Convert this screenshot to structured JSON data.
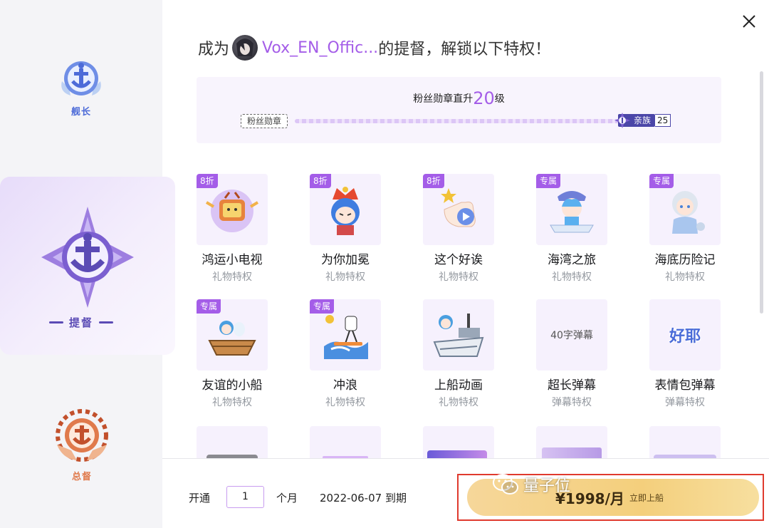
{
  "left_rail": {
    "ranks": [
      {
        "label": "舰长"
      },
      {
        "label": "提督"
      },
      {
        "label": "总督"
      }
    ]
  },
  "heading": {
    "prefix": "成为",
    "streamer_name": "Vox_EN_Offic...",
    "suffix": "的提督，解锁以下特权！"
  },
  "medal": {
    "title_prefix": "粉丝勋章直升",
    "level": "20",
    "title_suffix": "级",
    "start_label": "粉丝勋章",
    "end_badge": "亲族",
    "end_level": "25"
  },
  "privileges": [
    {
      "tag": "8折",
      "title": "鸿运小电视",
      "sub": "礼物特权"
    },
    {
      "tag": "8折",
      "title": "为你加冕",
      "sub": "礼物特权"
    },
    {
      "tag": "8折",
      "title": "这个好诶",
      "sub": "礼物特权"
    },
    {
      "tag": "专属",
      "title": "海湾之旅",
      "sub": "礼物特权"
    },
    {
      "tag": "专属",
      "title": "海底历险记",
      "sub": "礼物特权"
    },
    {
      "tag": "专属",
      "title": "友谊的小船",
      "sub": "礼物特权"
    },
    {
      "tag": "专属",
      "title": "冲浪",
      "sub": "礼物特权"
    },
    {
      "tag": "",
      "title": "上船动画",
      "sub": "礼物特权"
    },
    {
      "tag": "",
      "title": "超长弹幕",
      "sub": "弹幕特权",
      "thumb_text": "40字弹幕"
    },
    {
      "tag": "",
      "title": "表情包弹幕",
      "sub": "弹幕特权",
      "thumb_text": "好耶"
    }
  ],
  "footer": {
    "open_label": "开通",
    "quantity": "1",
    "unit_label": "个月",
    "expiry": "2022-06-07 到期",
    "price": "¥1998/月",
    "cta": "立即上船"
  },
  "watermark": "量子位",
  "colors": {
    "accent_purple": "#a45de8",
    "rail_bg": "#f4f4f7",
    "pay_gold": "#f4cf7c",
    "highlight_red": "#e03a2e"
  }
}
